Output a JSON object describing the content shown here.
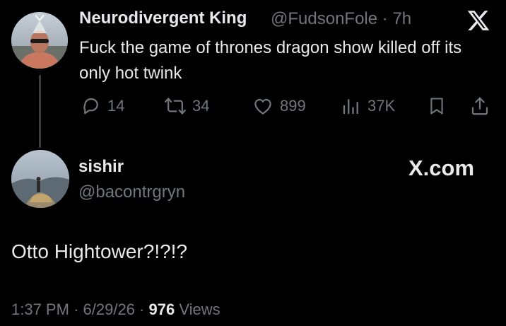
{
  "parent_tweet": {
    "display_name": "Neurodivergent King",
    "handle": "@FudsonFole",
    "separator": "·",
    "time_ago": "7h",
    "text": "Fuck the game of thrones dragon show killed off its only hot twink",
    "actions": {
      "replies": "14",
      "reposts": "34",
      "likes": "899",
      "views": "37K"
    },
    "icons": [
      "reply-icon",
      "repost-icon",
      "like-icon",
      "views-icon",
      "bookmark-icon",
      "share-icon"
    ]
  },
  "quote_tweet": {
    "display_name": "sishir",
    "handle": "@bacontrgryn",
    "brand": "X.com",
    "text": "Otto Hightower?!?!?",
    "time": "1:37 PM",
    "date": "6/29/26",
    "separator": "·",
    "views_count": "976",
    "views_label": "Views"
  },
  "colors": {
    "background": "#000000",
    "primary_text": "#e7e9ea",
    "secondary_text": "#71767b",
    "thread_line": "#3a3d41"
  }
}
